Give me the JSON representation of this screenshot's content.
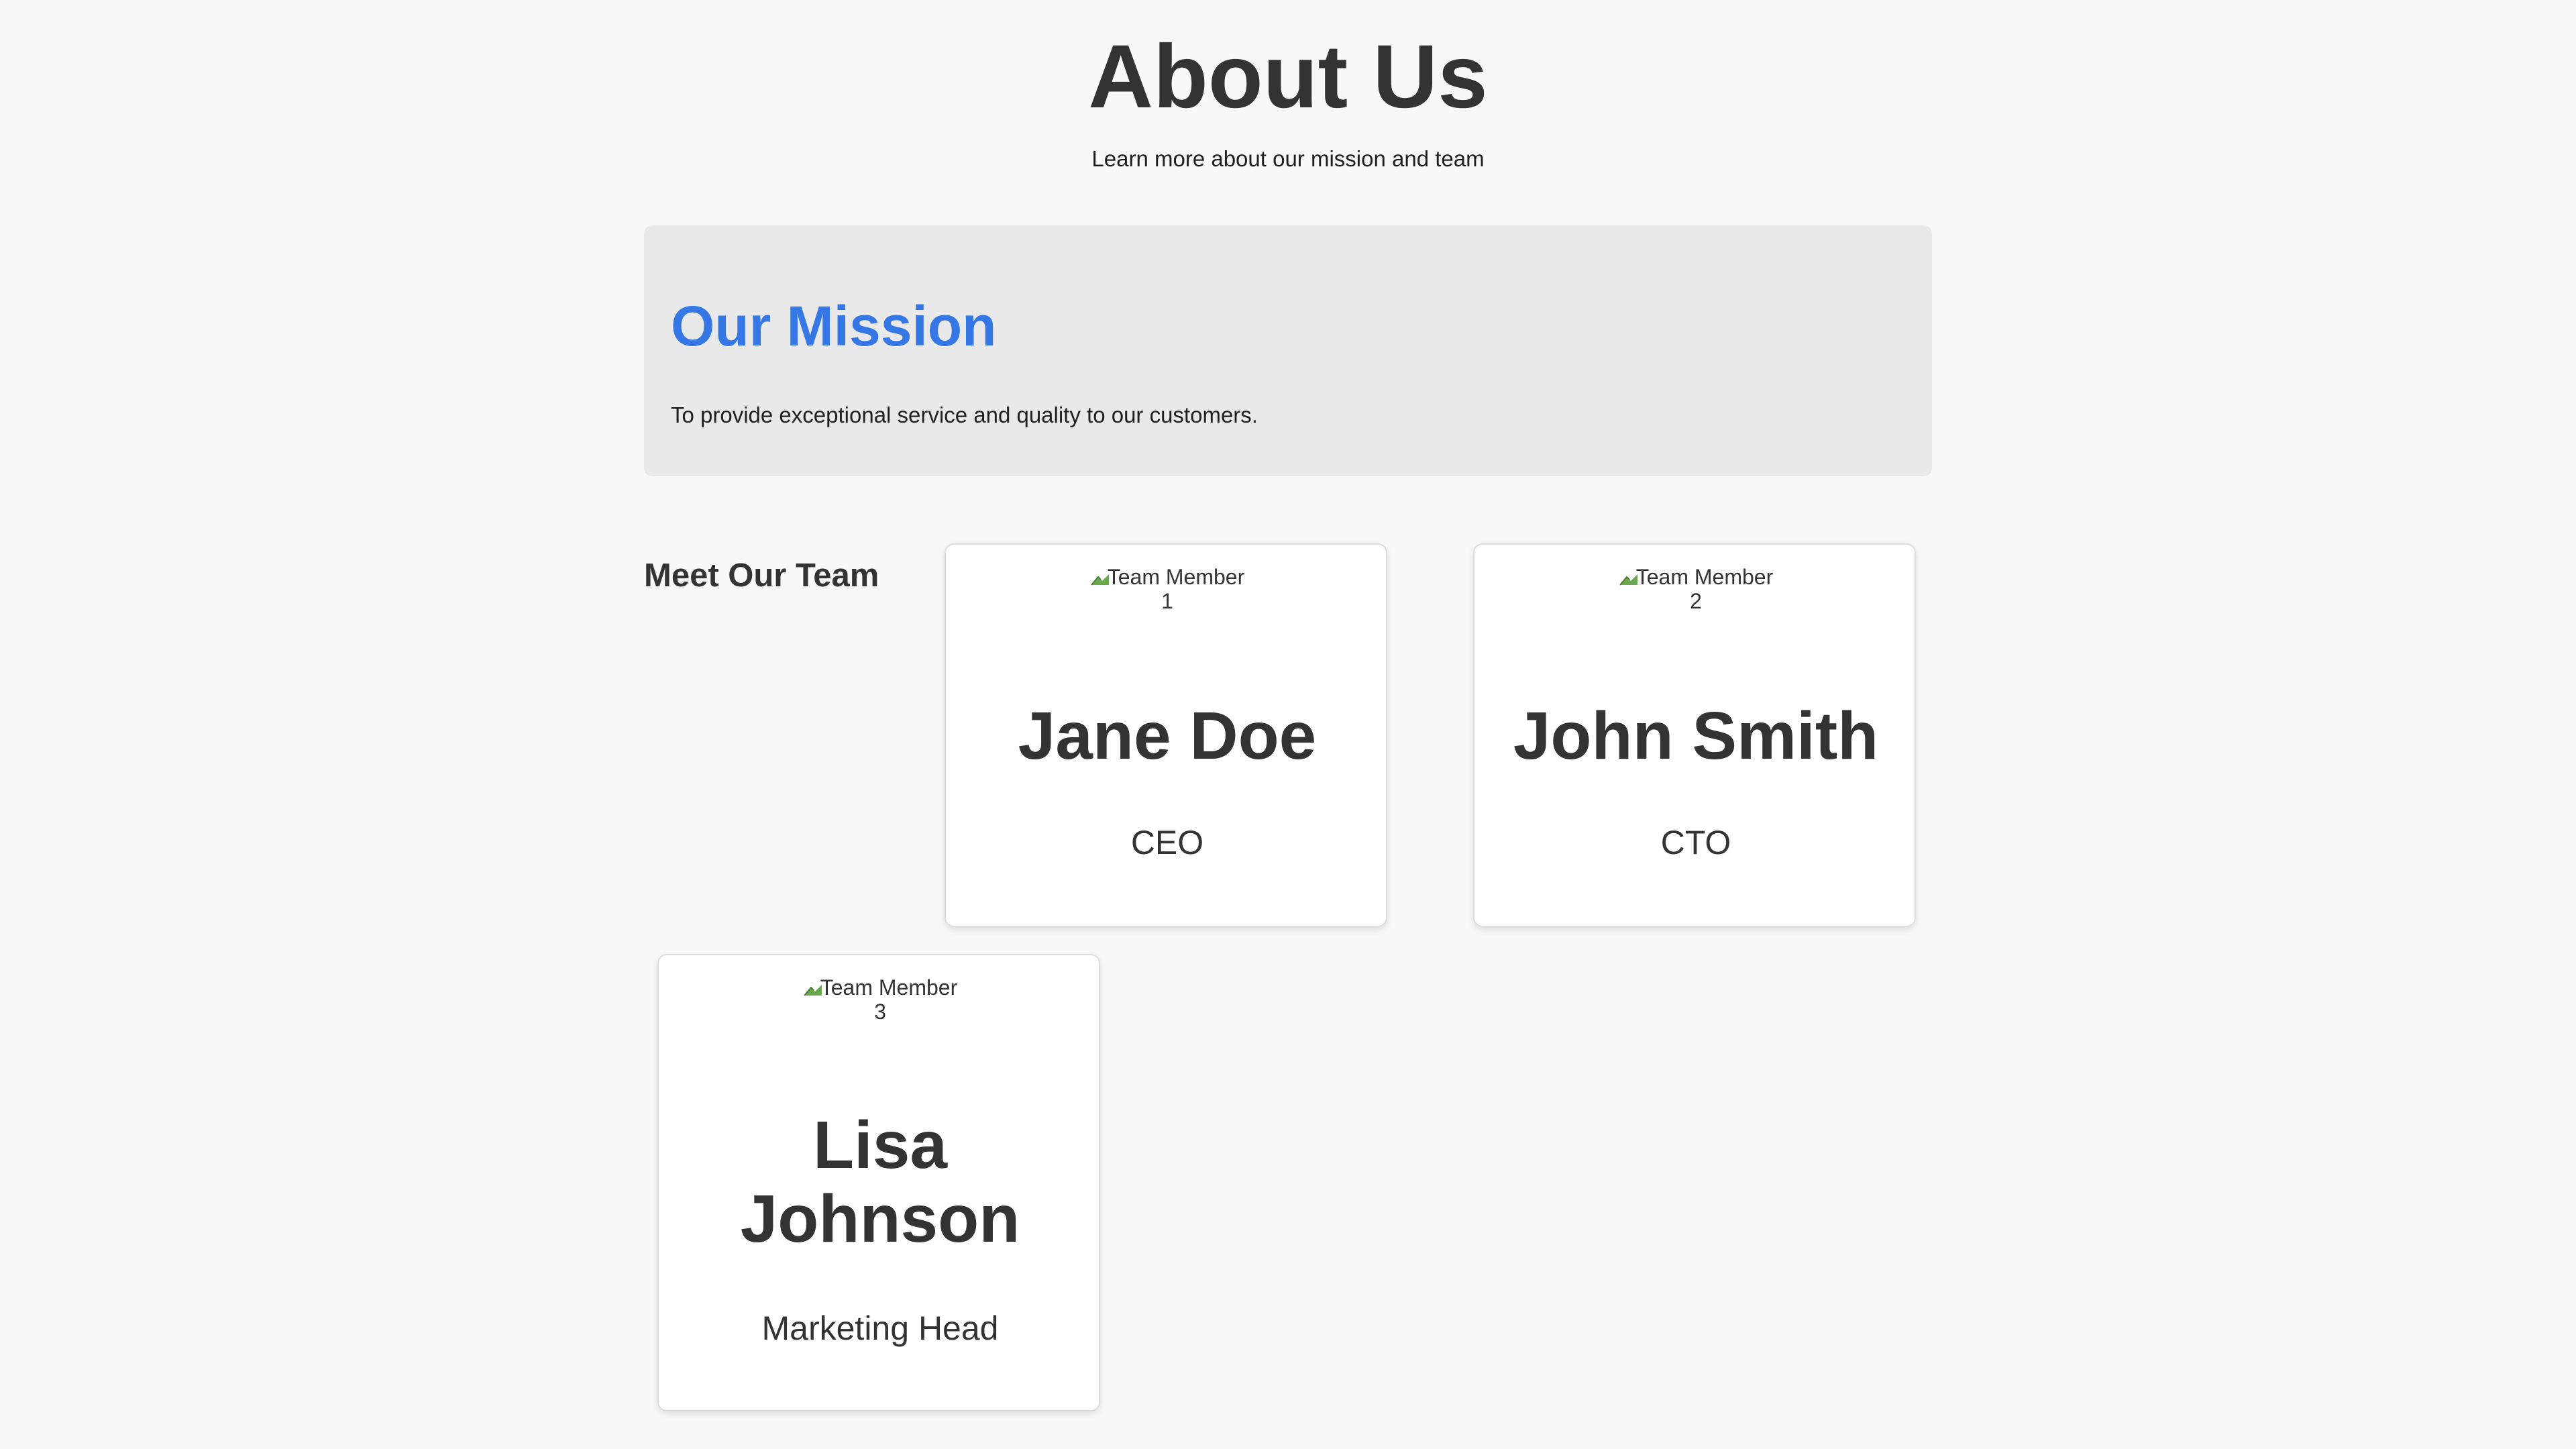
{
  "header": {
    "title": "About Us",
    "subtitle": "Learn more about our mission and team"
  },
  "mission": {
    "title": "Our Mission",
    "text": "To provide exceptional service and quality to our customers."
  },
  "team": {
    "heading": "Meet Our Team",
    "members": [
      {
        "image_alt": "Team Member 1",
        "name": "Jane Doe",
        "role": "CEO"
      },
      {
        "image_alt": "Team Member 2",
        "name": "John Smith",
        "role": "CTO"
      },
      {
        "image_alt": "Team Member 3",
        "name": "Lisa Johnson",
        "role": "Marketing Head"
      }
    ]
  },
  "colors": {
    "background": "#f8f8f8",
    "mission_background": "#e9e9e9",
    "accent": "#3578e5",
    "text": "#333333"
  },
  "icons": {
    "broken_image": "broken-image-icon"
  }
}
